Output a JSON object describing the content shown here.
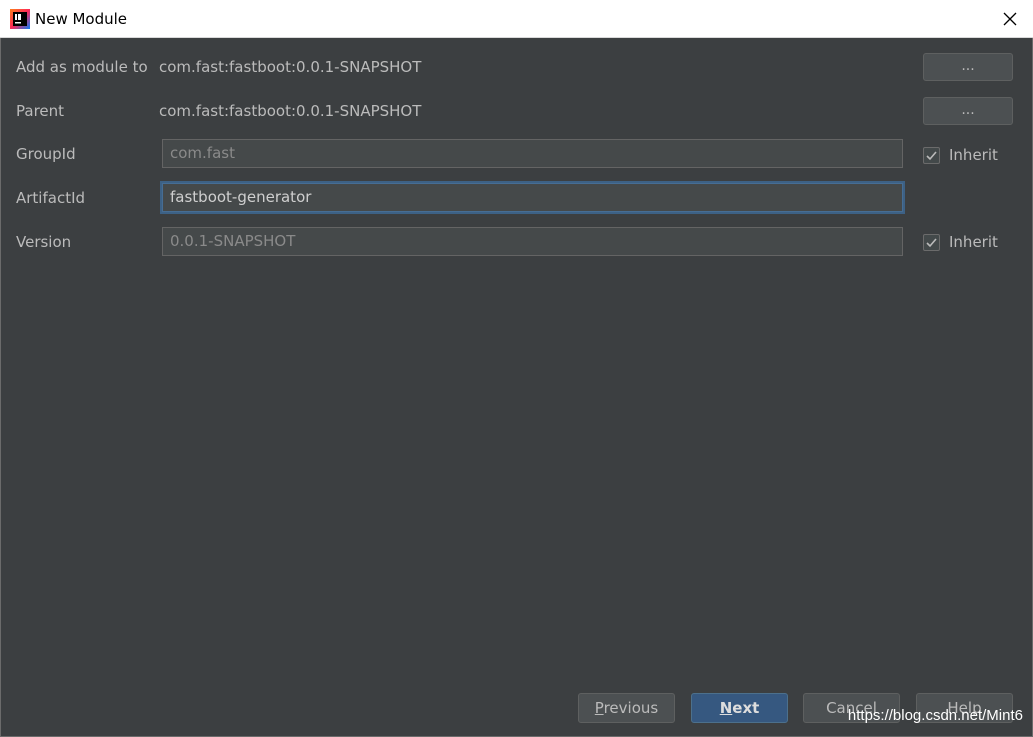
{
  "window": {
    "title": "New Module",
    "icon": "intellij-idea-icon"
  },
  "form": {
    "add_as_module_to": {
      "label": "Add as module to",
      "value": "com.fast:fastboot:0.0.1-SNAPSHOT",
      "browse_label": "..."
    },
    "parent": {
      "label": "Parent",
      "value": "com.fast:fastboot:0.0.1-SNAPSHOT",
      "browse_label": "..."
    },
    "group_id": {
      "label": "GroupId",
      "value": "com.fast",
      "inherit_label": "Inherit",
      "inherit_checked": true
    },
    "artifact_id": {
      "label": "ArtifactId",
      "value": "fastboot-generator"
    },
    "version": {
      "label": "Version",
      "value": "0.0.1-SNAPSHOT",
      "inherit_label": "Inherit",
      "inherit_checked": true
    }
  },
  "footer": {
    "previous": {
      "mnemonic": "P",
      "rest": "revious"
    },
    "next": {
      "mnemonic": "N",
      "rest": "ext"
    },
    "cancel": "Cancel",
    "help": "Help"
  },
  "watermark": "https://blog.csdn.net/Mint6",
  "colors": {
    "background": "#3c3f41",
    "primary_button": "#365880",
    "focus_border": "#466d94"
  }
}
